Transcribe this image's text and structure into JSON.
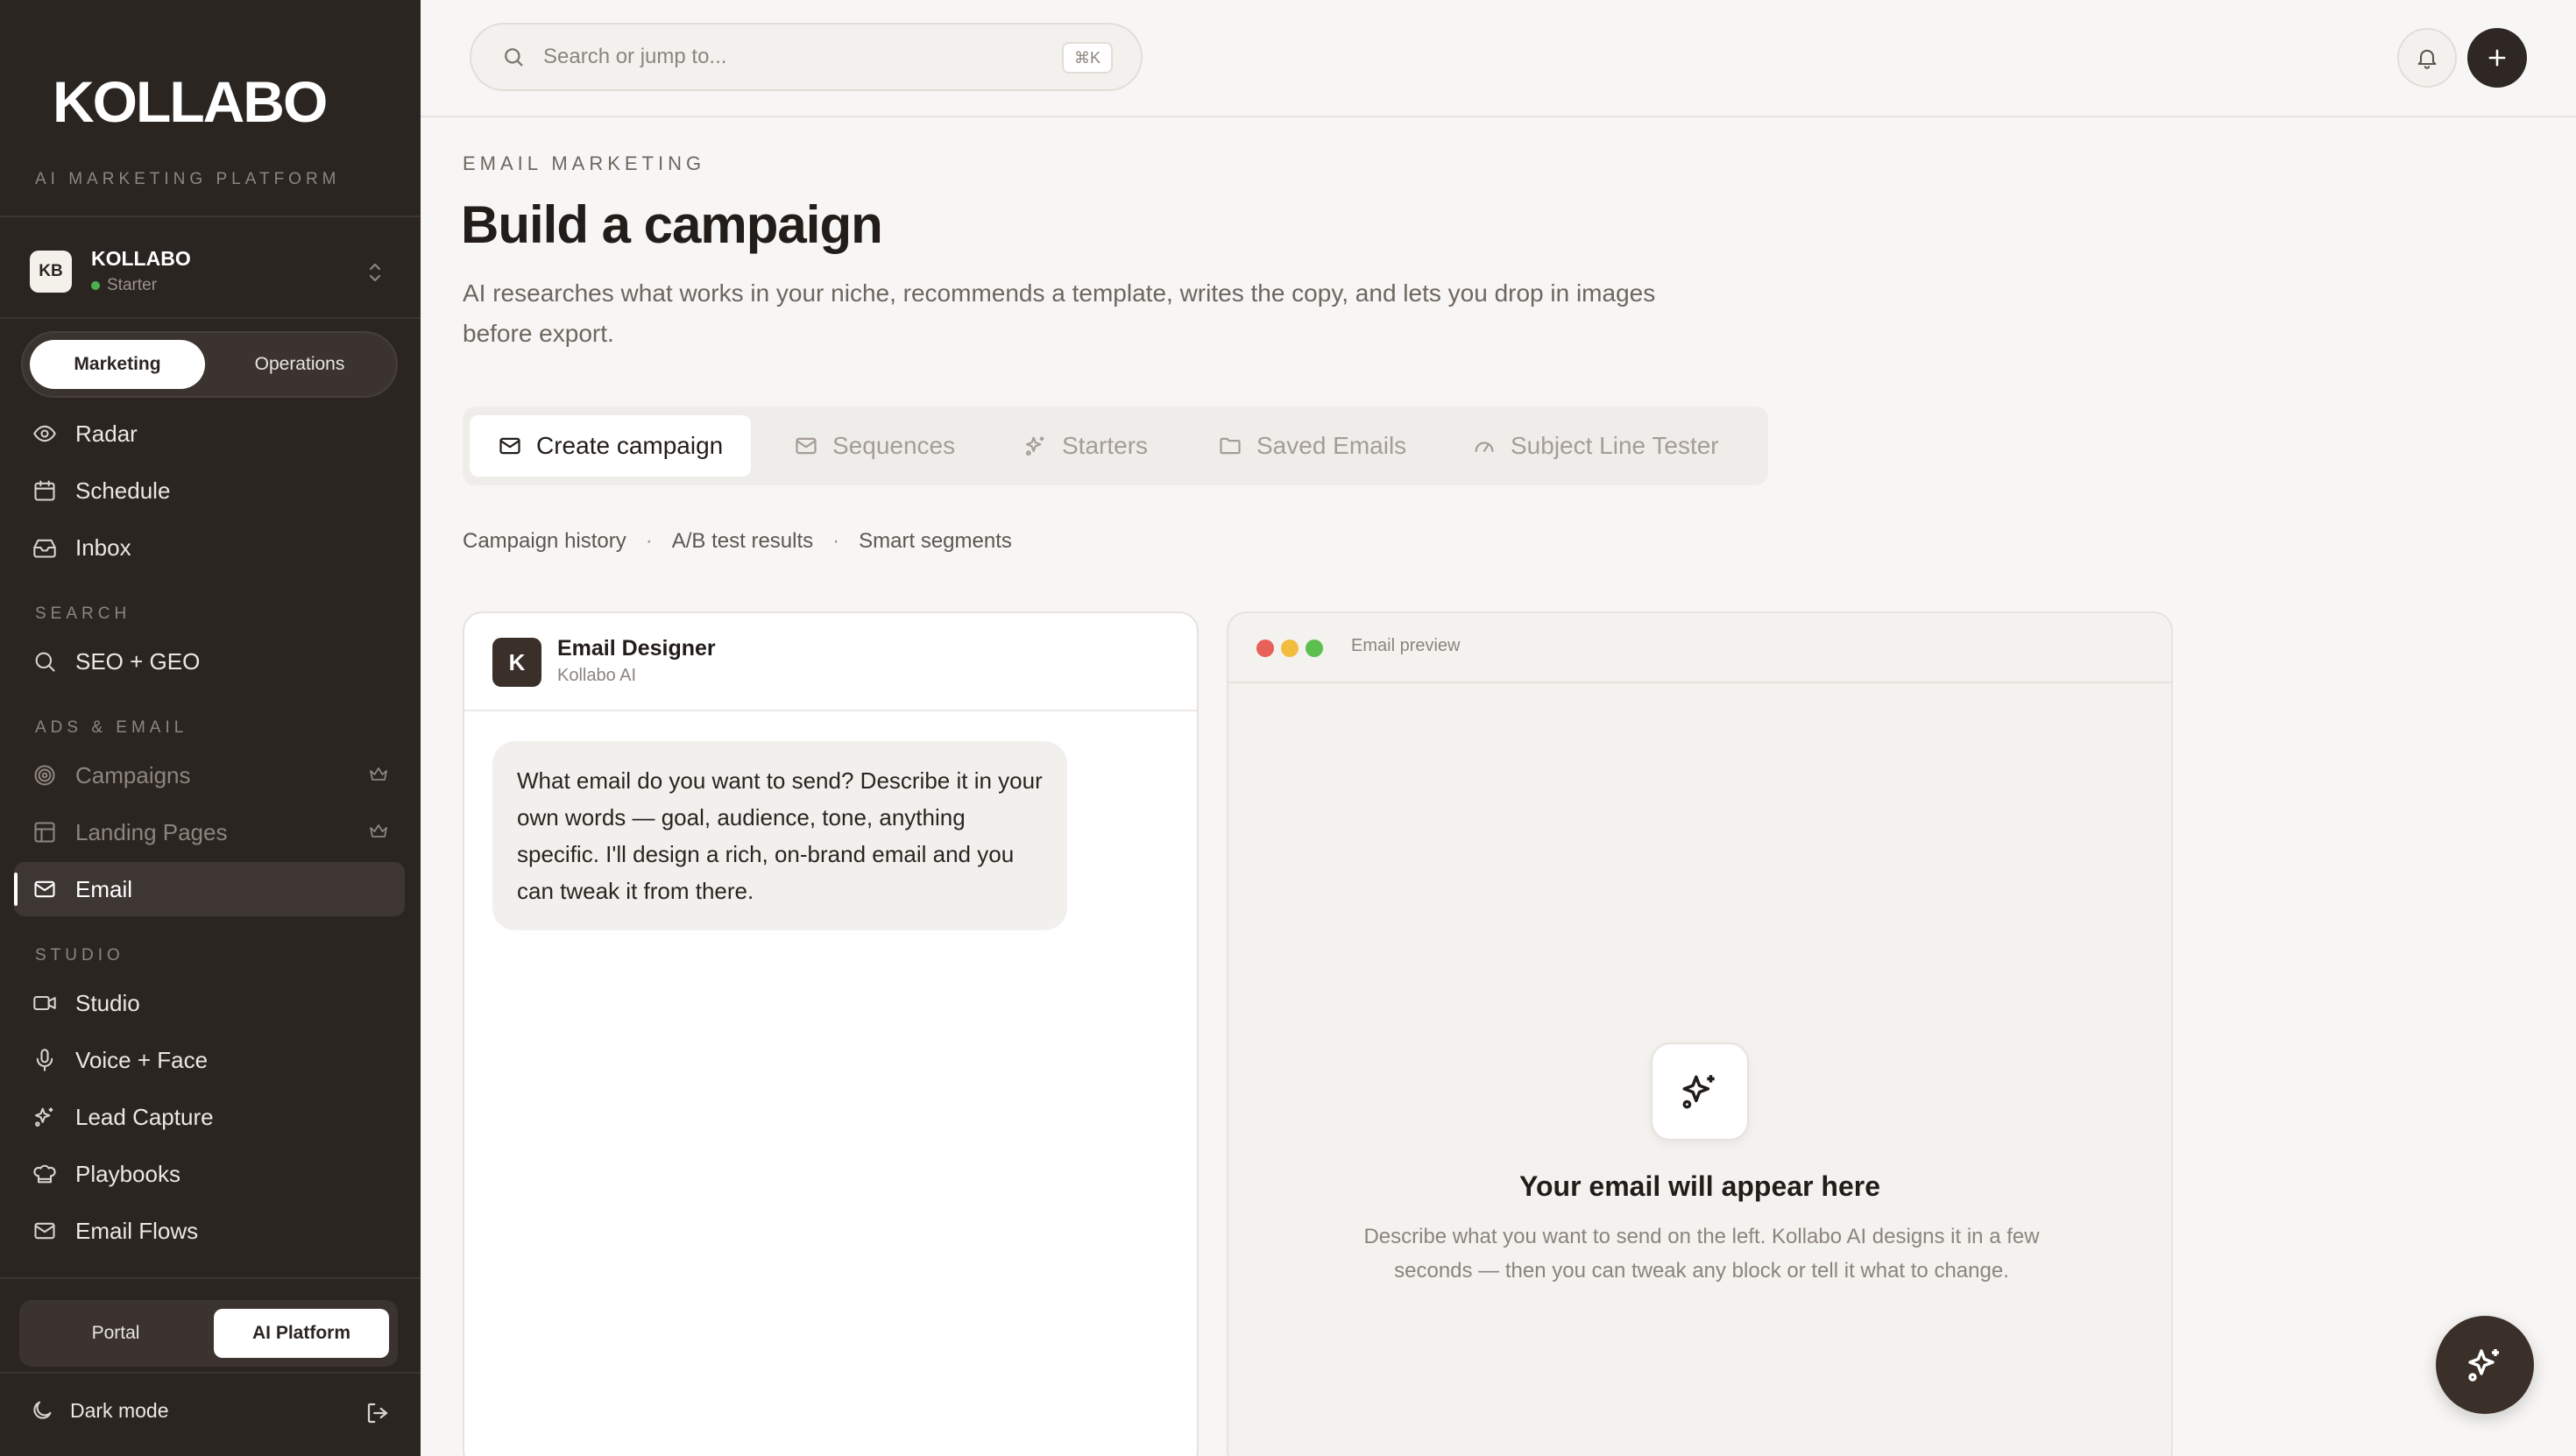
{
  "app": {
    "logo": "KOLLABO",
    "tagline": "AI MARKETING PLATFORM"
  },
  "workspace": {
    "badge": "KB",
    "name": "KOLLABO",
    "plan": "Starter"
  },
  "mode_toggle": {
    "marketing": "Marketing",
    "operations": "Operations"
  },
  "nav": {
    "radar": "Radar",
    "schedule": "Schedule",
    "inbox": "Inbox",
    "search_header": "SEARCH",
    "seo_geo": "SEO + GEO",
    "ads_header": "ADS & EMAIL",
    "campaigns": "Campaigns",
    "landing_pages": "Landing Pages",
    "email": "Email",
    "studio_header": "STUDIO",
    "studio": "Studio",
    "voice_face": "Voice + Face",
    "lead_capture": "Lead Capture",
    "playbooks": "Playbooks",
    "email_flows": "Email Flows"
  },
  "bottom_toggle": {
    "portal": "Portal",
    "ai_platform": "AI Platform"
  },
  "footer": {
    "dark_mode": "Dark mode"
  },
  "topbar": {
    "search_placeholder": "Search or jump to...",
    "shortcut": "⌘K"
  },
  "page": {
    "eyebrow": "EMAIL MARKETING",
    "title": "Build a campaign",
    "description": "AI researches what works in your niche, recommends a template, writes the copy, and lets you drop in images before export."
  },
  "tabs": {
    "create": "Create campaign",
    "sequences": "Sequences",
    "starters": "Starters",
    "saved": "Saved Emails",
    "subject": "Subject Line Tester"
  },
  "sublinks": {
    "history": "Campaign history",
    "ab": "A/B test results",
    "segments": "Smart segments",
    "sep": "·"
  },
  "chat": {
    "avatar": "K",
    "title": "Email Designer",
    "subtitle": "Kollabo AI",
    "message": "What email do you want to send? Describe it in your own words — goal, audience, tone, anything specific. I'll design a rich, on-brand email and you can tweak it from there."
  },
  "preview": {
    "label": "Email preview",
    "heading": "Your email will appear here",
    "description": "Describe what you want to send on the left. Kollabo AI designs it in a few seconds — then you can tweak any block or tell it what to change."
  },
  "colors": {
    "sidebar_bg": "#2b2522",
    "accent_dark": "#3a2f29",
    "background": "#f7f6f4",
    "status_green": "#4caf50",
    "traffic_red": "#e8605a",
    "traffic_yellow": "#f2bc3f",
    "traffic_green": "#5cbf4e"
  }
}
